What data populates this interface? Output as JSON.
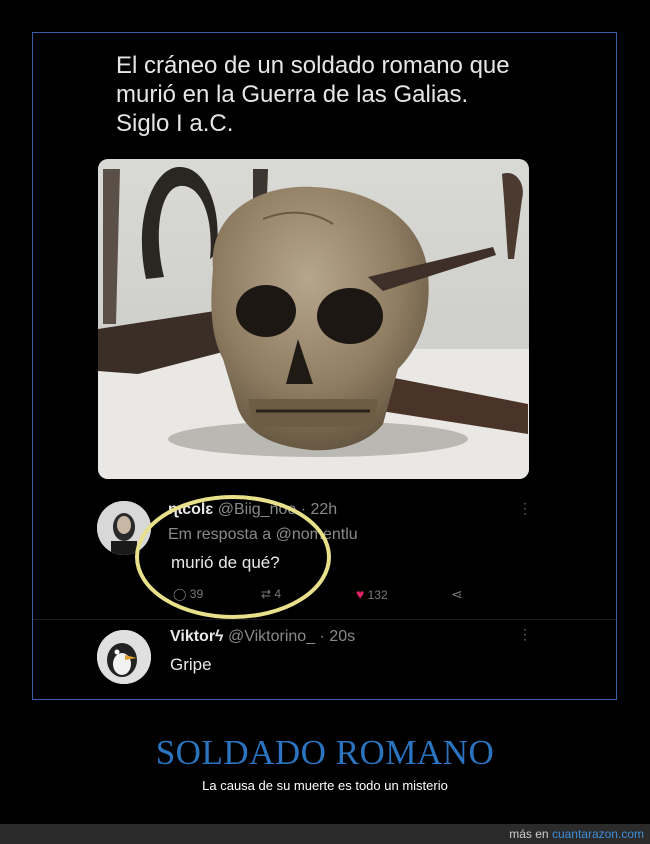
{
  "post": {
    "lines": [
      "El cráneo de un soldado romano que",
      "murió en la Guerra de las Galias.",
      "Siglo I a.C."
    ]
  },
  "tweet1": {
    "name": "ɳɩcolɛ",
    "handle": "@Biig_no",
    "handle_tail": "e · 22h",
    "reply_prefix": "Em resposta a @n",
    "reply_tail": "omentlu",
    "text": "murió de qué?",
    "replies": "39",
    "retweets": "4",
    "likes": "132"
  },
  "tweet2": {
    "name": "Viktorϟ",
    "handle": "@Viktorino_ · 20s",
    "text": "Gripe"
  },
  "caption": {
    "title": "SOLDADO ROMANO",
    "subtitle": "La causa de su muerte es todo un misterio"
  },
  "footer": {
    "prefix": "más en",
    "site": "cuantarazon.com"
  },
  "colors": {
    "accent": "#2a74c0",
    "frame_border": "#3a5fa8",
    "highlight_circle": "#e8e08a",
    "like_heart": "#e0245e"
  }
}
